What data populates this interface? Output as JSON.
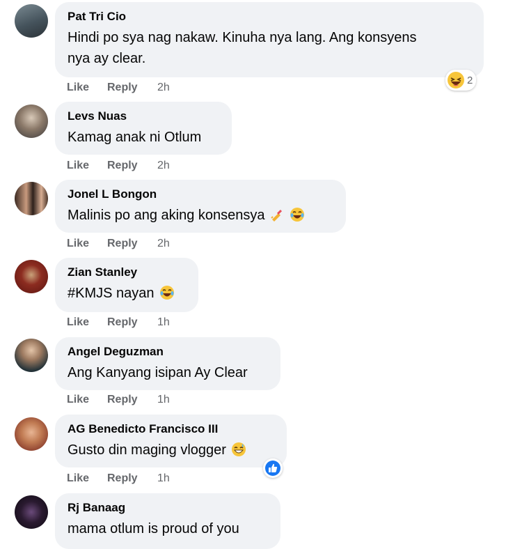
{
  "comments": [
    {
      "name": "Pat Tri Cio",
      "text_lines": [
        "Hindi po sya nag nakaw. Kinuha nya lang. Ang konsyens",
        "nya ay clear."
      ],
      "like": "Like",
      "reply": "Reply",
      "time": "2h",
      "reaction": {
        "icon": "laughing-emoji",
        "count": "2"
      }
    },
    {
      "name": "Levs Nuas",
      "text_lines": [
        "Kamag anak ni Otlum"
      ],
      "like": "Like",
      "reply": "Reply",
      "time": "2h"
    },
    {
      "name": "Jonel L Bongon",
      "text_lines": [
        "Malinis po ang aking konsensya"
      ],
      "emojis": [
        "nail-polish-emoji",
        "tears-of-joy-emoji"
      ],
      "like": "Like",
      "reply": "Reply",
      "time": "2h"
    },
    {
      "name": "Zian Stanley",
      "text_lines": [
        "#KMJS nayan"
      ],
      "emojis": [
        "tears-of-joy-emoji"
      ],
      "like": "Like",
      "reply": "Reply",
      "time": "1h"
    },
    {
      "name": "Angel Deguzman",
      "text_lines": [
        "Ang Kanyang isipan Ay Clear"
      ],
      "like": "Like",
      "reply": "Reply",
      "time": "1h"
    },
    {
      "name": "AG Benedicto Francisco III",
      "text_lines": [
        "Gusto din maging vlogger"
      ],
      "emojis": [
        "grinning-sweat-emoji"
      ],
      "like": "Like",
      "reply": "Reply",
      "time": "1h",
      "reaction": {
        "icon": "thumbs-up-icon",
        "count": ""
      }
    },
    {
      "name": "Rj Banaag",
      "text_lines": [
        "mama otlum is proud of you"
      ]
    }
  ],
  "colors": {
    "bubble": "#f0f2f5",
    "action_text": "#65676b",
    "like_blue": "#1877f2"
  }
}
